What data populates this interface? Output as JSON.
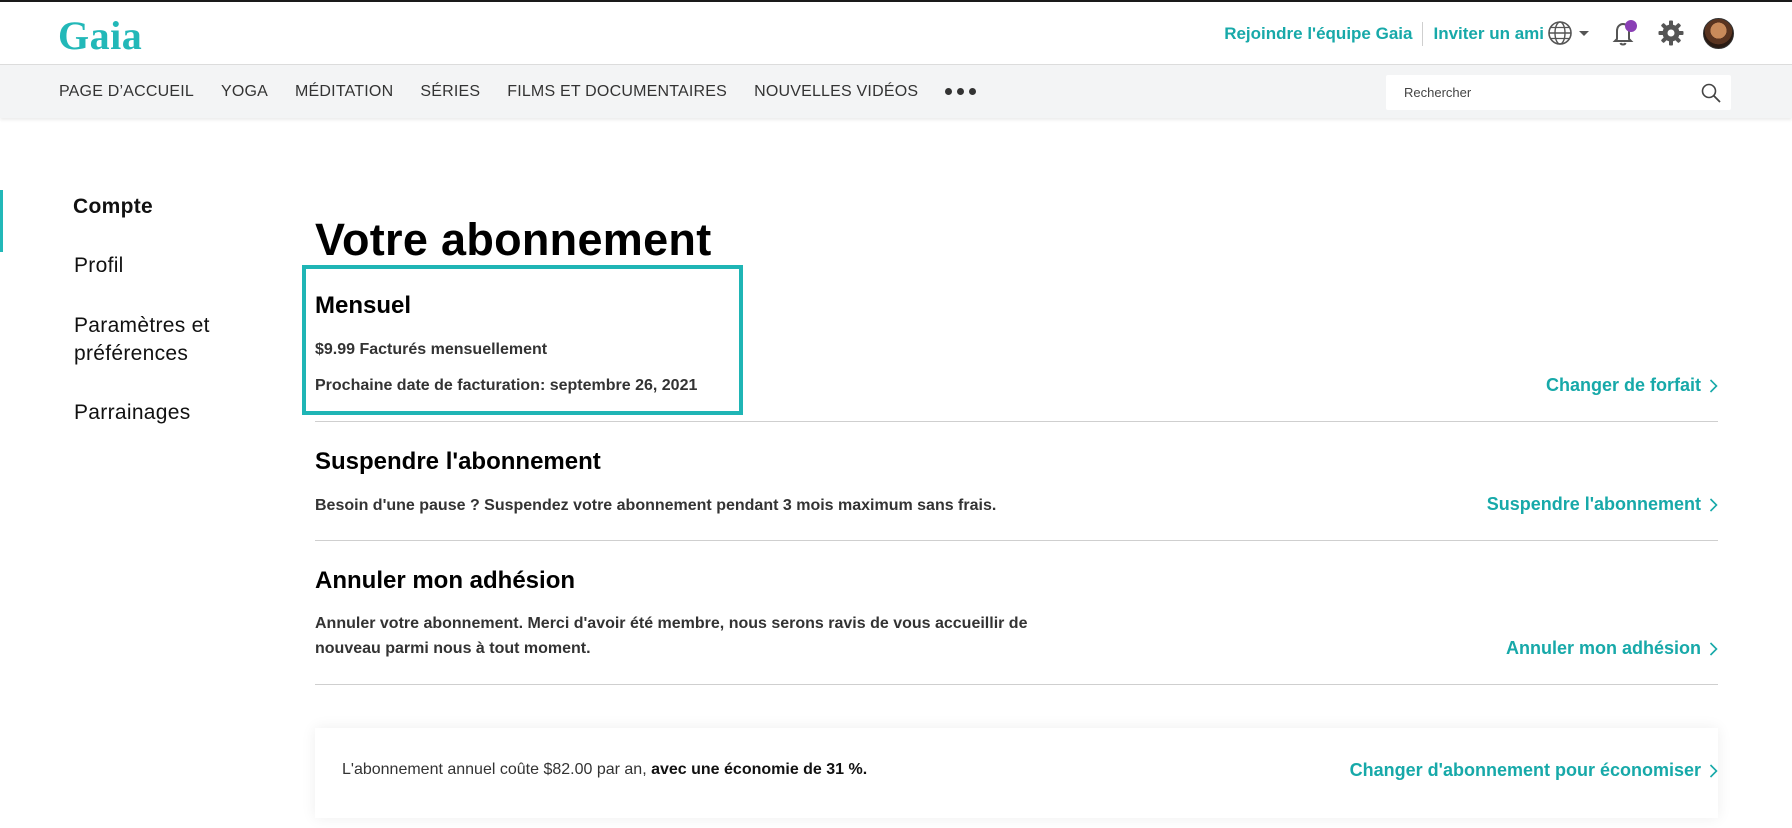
{
  "brand": {
    "logo_text": "Gaia",
    "accent_color": "#1fb5b5"
  },
  "header": {
    "links": [
      "Rejoindre l'équipe Gaia",
      "Inviter un ami"
    ],
    "icons": [
      "globe-icon",
      "chevron-down-icon",
      "bell-icon",
      "gear-icon",
      "avatar"
    ]
  },
  "nav": {
    "items": [
      "PAGE D’ACCUEIL",
      "YOGA",
      "MÉDITATION",
      "SÉRIES",
      "FILMS ET DOCUMENTAIRES",
      "NOUVELLES VIDÉOS"
    ],
    "more_icon": "more-dots-icon",
    "search_placeholder": "Rechercher"
  },
  "sidebar": {
    "items": [
      {
        "label": "Compte",
        "active": true
      },
      {
        "label": "Profil",
        "active": false
      },
      {
        "label": "Paramètres et préférences",
        "active": false
      },
      {
        "label": "Parrainages",
        "active": false
      }
    ]
  },
  "main": {
    "title": "Votre abonnement",
    "plan": {
      "name": "Mensuel",
      "price": "$9.99 Facturés mensuellement",
      "next_billing": "Prochaine date de facturation: septembre 26, 2021",
      "action": "Changer de forfait"
    },
    "suspend": {
      "title": "Suspendre l'abonnement",
      "desc": "Besoin d'une pause ? Suspendez votre abonnement pendant 3 mois maximum sans frais.",
      "action": "Suspendre l'abonnement"
    },
    "cancel": {
      "title": "Annuler mon adhésion",
      "desc_line1": "Annuler votre abonnement. Merci d'avoir été membre, nous serons ravis de vous accueillir de",
      "desc_line2": "nouveau parmi nous à tout moment.",
      "action": "Annuler mon adhésion"
    },
    "promo": {
      "text": "L'abonnement annuel coûte $82.00 par an,",
      "highlight": "avec une économie de 31 %.",
      "action": "Changer d'abonnement pour économiser"
    }
  }
}
